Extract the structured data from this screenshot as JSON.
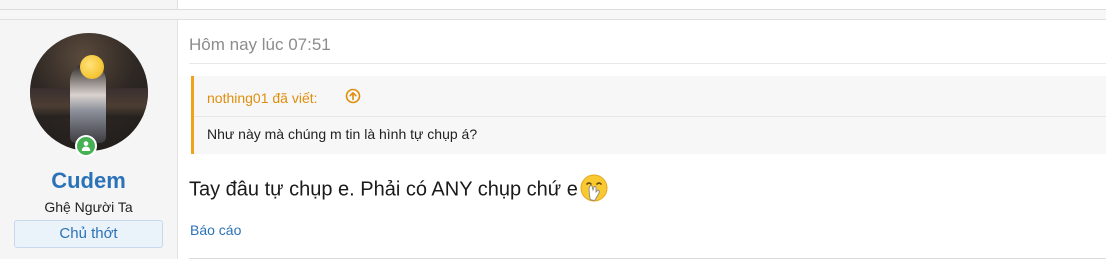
{
  "post": {
    "user": {
      "name": "Cudem",
      "title": "Ghệ Người Ta",
      "banner": "Chủ thớt",
      "online_status_icon": "user-online-icon"
    },
    "timestamp": "Hôm nay lúc 07:51",
    "quote": {
      "author_label": "nothing01 đã viết:",
      "jump_icon": "arrow-up-circle-icon",
      "text": "Như này mà chúng m tin là hình tự chụp á?"
    },
    "message": "Tay đâu tự chụp e. Phải có ANY chụp chứ e",
    "emoji": "hand-over-mouth-emoji",
    "actions": {
      "report": "Báo cáo"
    }
  },
  "colors": {
    "accent_blue": "#2b72b8",
    "quote_orange": "#f0a21b",
    "online_green": "#46b054"
  }
}
